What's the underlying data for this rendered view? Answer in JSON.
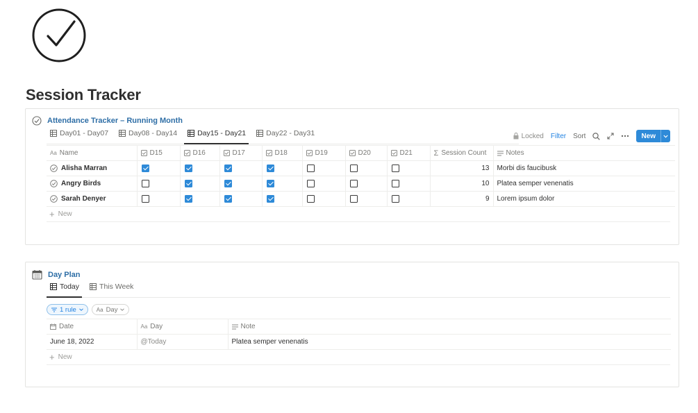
{
  "page": {
    "title": "Session Tracker"
  },
  "attendance": {
    "title": "Attendance Tracker – Running Month",
    "tabs": [
      {
        "label": "Day01 - Day07",
        "active": false
      },
      {
        "label": "Day08 - Day14",
        "active": false
      },
      {
        "label": "Day15 - Day21",
        "active": true
      },
      {
        "label": "Day22 - Day31",
        "active": false
      }
    ],
    "toolbar": {
      "locked": "Locked",
      "filter": "Filter",
      "sort": "Sort",
      "new": "New"
    },
    "columns": {
      "name": "Name",
      "d15": "D15",
      "d16": "D16",
      "d17": "D17",
      "d18": "D18",
      "d19": "D19",
      "d20": "D20",
      "d21": "D21",
      "count": "Session Count",
      "notes": "Notes"
    },
    "rows": [
      {
        "name": "Alisha Marran",
        "checks": [
          true,
          true,
          true,
          true,
          false,
          false,
          false
        ],
        "count": "13",
        "notes": "Morbi dis faucibusk"
      },
      {
        "name": "Angry Birds",
        "checks": [
          false,
          true,
          true,
          true,
          false,
          false,
          false
        ],
        "count": "10",
        "notes": "Platea semper venenatis"
      },
      {
        "name": "Sarah Denyer",
        "checks": [
          false,
          true,
          true,
          true,
          false,
          false,
          false
        ],
        "count": "9",
        "notes": "Lorem ipsum dolor"
      }
    ],
    "new_row": "New"
  },
  "dayplan": {
    "title": "Day Plan",
    "tabs": [
      {
        "label": "Today",
        "active": true
      },
      {
        "label": "This Week",
        "active": false
      }
    ],
    "chips": {
      "rule": "1 rule",
      "day": "Day"
    },
    "columns": {
      "date": "Date",
      "day": "Day",
      "note": "Note"
    },
    "rows": [
      {
        "date": "June 18, 2022",
        "day": "@Today",
        "note": "Platea semper venenatis"
      }
    ],
    "new_row": "New"
  },
  "colors": {
    "accent": "#2e8ad8",
    "link": "#2e6ea6",
    "text": "#37352f"
  },
  "icons": {
    "page": "check-circle-icon",
    "attendance": "check-circle-icon",
    "dayplan": "calendar-icon"
  }
}
